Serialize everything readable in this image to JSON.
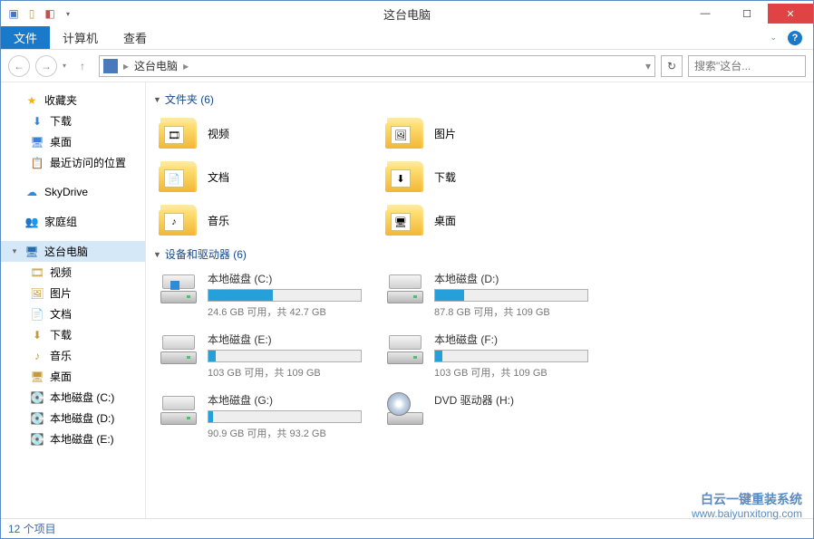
{
  "window": {
    "title": "这台电脑"
  },
  "ribbon": {
    "file": "文件",
    "tabs": [
      "计算机",
      "查看"
    ]
  },
  "addressbar": {
    "crumb": "这台电脑",
    "search_placeholder": "搜索\"这台...",
    "search_icon": "🔍"
  },
  "sidebar": {
    "favorites": {
      "label": "收藏夹",
      "icon": "★",
      "color": "#f5b01a",
      "items": [
        {
          "label": "下载",
          "icon": "⬇",
          "color": "#3a82d8"
        },
        {
          "label": "桌面",
          "icon": "🖥",
          "color": "#3a82d8"
        },
        {
          "label": "最近访问的位置",
          "icon": "📋",
          "color": "#6b8a5a"
        }
      ]
    },
    "skydrive": {
      "label": "SkyDrive",
      "icon": "☁",
      "color": "#2e8bd8"
    },
    "homegroup": {
      "label": "家庭组",
      "icon": "👥",
      "color": "#3a9a5a"
    },
    "thispc": {
      "label": "这台电脑",
      "icon": "🖥",
      "color": "#2a6ab0",
      "items": [
        {
          "label": "视频",
          "icon": "🎞",
          "color": "#c59a3a"
        },
        {
          "label": "图片",
          "icon": "🖼",
          "color": "#c59a3a"
        },
        {
          "label": "文档",
          "icon": "📄",
          "color": "#c59a3a"
        },
        {
          "label": "下载",
          "icon": "⬇",
          "color": "#c59a3a"
        },
        {
          "label": "音乐",
          "icon": "♪",
          "color": "#c59a3a"
        },
        {
          "label": "桌面",
          "icon": "🖥",
          "color": "#c59a3a"
        },
        {
          "label": "本地磁盘 (C:)",
          "icon": "💽",
          "color": "#8a8a8a"
        },
        {
          "label": "本地磁盘 (D:)",
          "icon": "💽",
          "color": "#8a8a8a"
        },
        {
          "label": "本地磁盘 (E:)",
          "icon": "💽",
          "color": "#8a8a8a"
        }
      ]
    }
  },
  "content": {
    "folders_header": "文件夹 (6)",
    "folders": [
      {
        "label": "视频",
        "badge": "🎞"
      },
      {
        "label": "图片",
        "badge": "🖼"
      },
      {
        "label": "文档",
        "badge": "📄"
      },
      {
        "label": "下载",
        "badge": "⬇"
      },
      {
        "label": "音乐",
        "badge": "♪"
      },
      {
        "label": "桌面",
        "badge": "🖥"
      }
    ],
    "drives_header": "设备和驱动器 (6)",
    "drives": [
      {
        "name": "本地磁盘 (C:)",
        "free": "24.6 GB 可用，共 42.7 GB",
        "pct": 42,
        "os": true
      },
      {
        "name": "本地磁盘 (D:)",
        "free": "87.8 GB 可用，共 109 GB",
        "pct": 19
      },
      {
        "name": "本地磁盘 (E:)",
        "free": "103 GB 可用，共 109 GB",
        "pct": 5
      },
      {
        "name": "本地磁盘 (F:)",
        "free": "103 GB 可用，共 109 GB",
        "pct": 5
      },
      {
        "name": "本地磁盘 (G:)",
        "free": "90.9 GB 可用，共 93.2 GB",
        "pct": 3
      },
      {
        "name": "DVD 驱动器 (H:)",
        "dvd": true
      }
    ]
  },
  "statusbar": {
    "text": "12 个项目"
  },
  "watermark": {
    "line1": "白云一键重装系统",
    "line2": "www.baiyunxitong.com"
  }
}
